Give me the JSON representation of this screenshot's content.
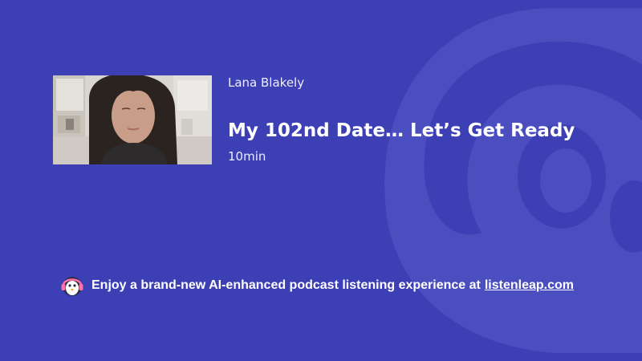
{
  "episode": {
    "author": "Lana Blakely",
    "title": "My 102nd Date… Let’s Get Ready",
    "duration": "10min"
  },
  "promo": {
    "text": "Enjoy a brand-new AI-enhanced podcast listening experience at",
    "link_label": "listenleap.com"
  },
  "icons": {
    "background": "listenleap-logo-watermark",
    "promo": "penguin-headphones-icon"
  },
  "colors": {
    "background": "#3d3fb4",
    "watermark": "#4b4fc0",
    "text": "#ffffff"
  }
}
